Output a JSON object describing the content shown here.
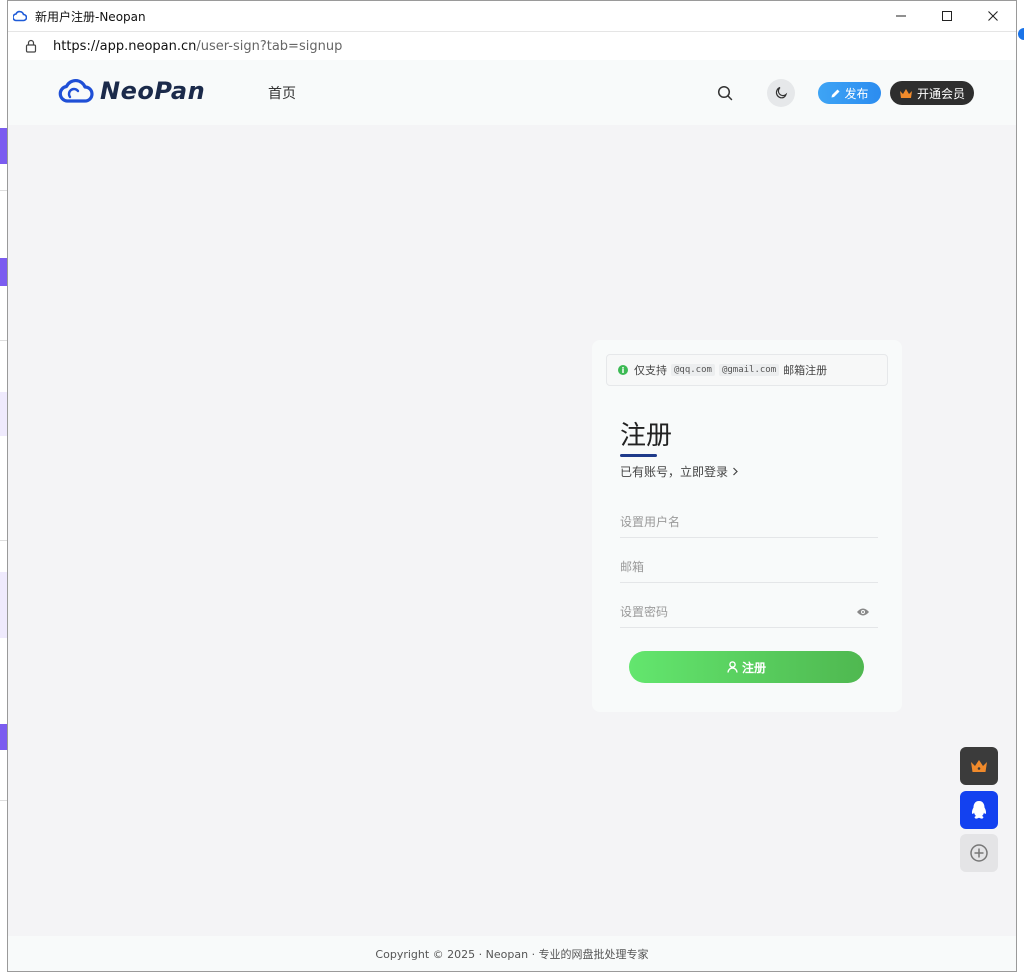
{
  "window": {
    "title": "新用户注册-Neopan",
    "controls": {
      "minimize": "—",
      "maximize": "☐",
      "close": "✕"
    }
  },
  "address": {
    "host": "https://app.neopan.cn",
    "rest": "/user-sign?tab=signup"
  },
  "nav": {
    "brand": "NeoPan",
    "home": "首页",
    "publish": "发布",
    "vip": "开通会员"
  },
  "notice": {
    "prefix": "仅支持",
    "domain1": "@qq.com",
    "domain2": "@gmail.com",
    "suffix": "邮箱注册"
  },
  "form": {
    "title": "注册",
    "login_link": "已有账号，立即登录",
    "username_placeholder": "设置用户名",
    "email_placeholder": "邮箱",
    "password_placeholder": "设置密码",
    "submit": "注册"
  },
  "footer": {
    "text": "Copyright © 2025 · Neopan · 专业的网盘批处理专家"
  },
  "colors": {
    "accent_blue": "#2b8cf0",
    "signup_green": "#5bd364",
    "qq_blue": "#1341f0",
    "vip_orange": "#f08a2b"
  }
}
